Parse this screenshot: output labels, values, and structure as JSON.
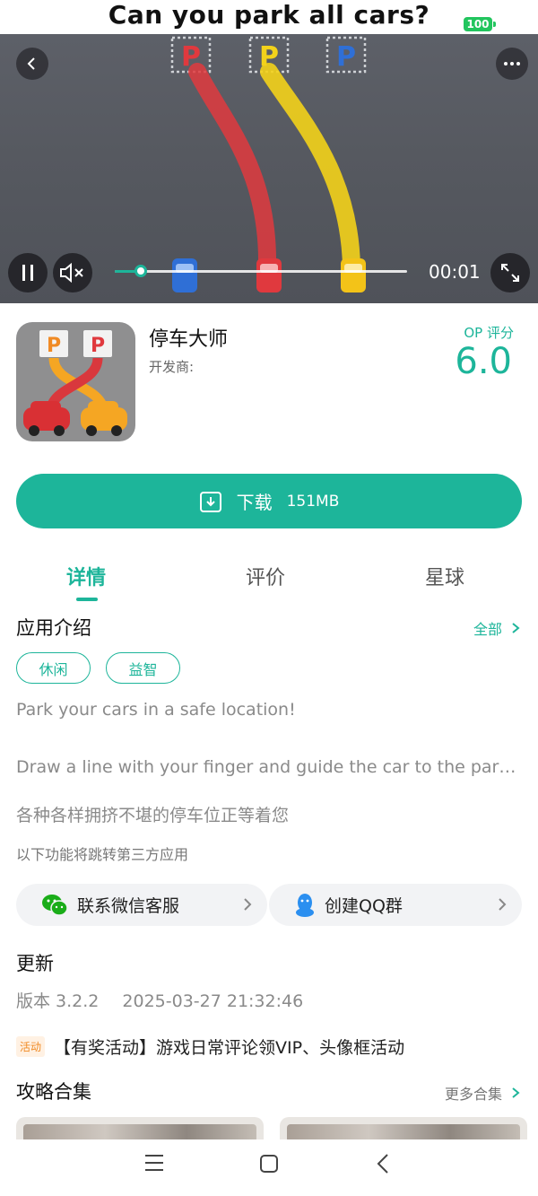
{
  "status_bar": {
    "title": "Can you park all cars?",
    "battery": "100"
  },
  "video": {
    "time": "00:01",
    "progress": 0.09,
    "parking_labels": [
      "P",
      "P",
      "P"
    ],
    "colors": {
      "red": "#e0393e",
      "yellow": "#f3d21a",
      "blue": "#2f6fd6"
    }
  },
  "app": {
    "name": "停车大师",
    "developer_label": "开发商:",
    "score_label": "OP 评分",
    "score_value": "6.0",
    "icon_labels": [
      "P",
      "P"
    ]
  },
  "download": {
    "label": "下载",
    "size": "151MB"
  },
  "tabs": [
    {
      "label": "详情",
      "active": true
    },
    {
      "label": "评价",
      "active": false
    },
    {
      "label": "星球",
      "active": false
    }
  ],
  "intro": {
    "title": "应用介绍",
    "all_link": "全部",
    "tags": [
      "休闲",
      "益智"
    ],
    "lines": [
      "Park your cars in a safe location!",
      "Draw a line with your finger and guide the car to the parking lot.",
      "各种各样拥挤不堪的停车位正等着您"
    ]
  },
  "third_party_note": "以下功能将跳转第三方应用",
  "contacts": [
    {
      "label": "联系微信客服",
      "icon": "wechat-icon"
    },
    {
      "label": "创建QQ群",
      "icon": "qq-icon"
    }
  ],
  "update": {
    "title": "更新",
    "version": "版本 3.2.2",
    "date": "2025-03-27 21:32:46",
    "activity_badge": "活动",
    "activity_text": "【有奖活动】游戏日常评论领VIP、头像框活动"
  },
  "guides": {
    "title": "攻略合集",
    "more_link": "更多合集"
  },
  "accent_color": "#1db59a"
}
